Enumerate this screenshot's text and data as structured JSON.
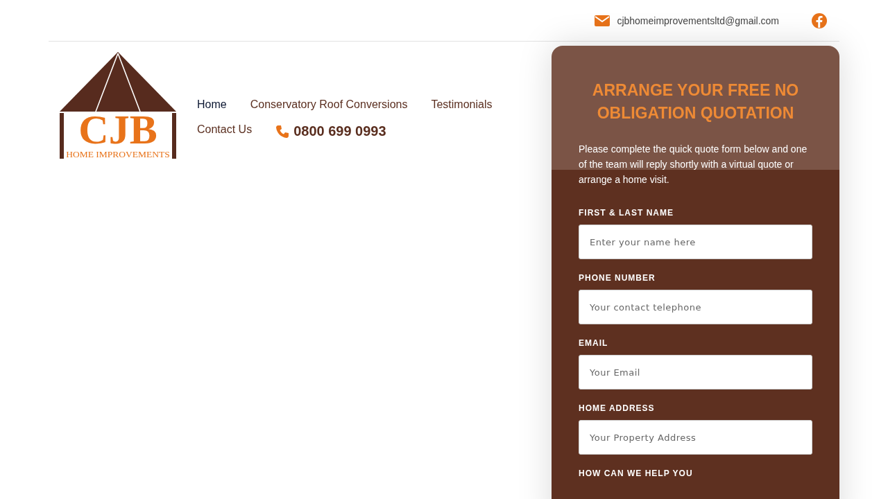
{
  "top_bar": {
    "email": "cjbhomeimprovementsltd@gmail.com"
  },
  "logo": {
    "initials": "CJB",
    "tagline": "HOME IMPROVEMENTS"
  },
  "nav": {
    "items": [
      {
        "label": "Home",
        "selected": true
      },
      {
        "label": "Conservatory Roof Conversions",
        "selected": false
      },
      {
        "label": "Testimonials",
        "selected": false
      },
      {
        "label": "Contact Us",
        "selected": false
      }
    ],
    "phone": "0800 699 0993"
  },
  "quote_form": {
    "title": "ARRANGE YOUR FREE NO OBLIGATION QUOTATION",
    "intro": "Please complete the quick quote form below and one of the team will reply shortly with a virtual quote or arrange a home visit.",
    "fields": [
      {
        "label": "FIRST & LAST NAME",
        "placeholder": "Enter your name here"
      },
      {
        "label": "PHONE NUMBER",
        "placeholder": "Your contact telephone"
      },
      {
        "label": "EMAIL",
        "placeholder": "Your Email"
      },
      {
        "label": "HOME ADDRESS",
        "placeholder": "Your Property Address"
      }
    ],
    "next_label": "HOW CAN WE HELP YOU"
  }
}
